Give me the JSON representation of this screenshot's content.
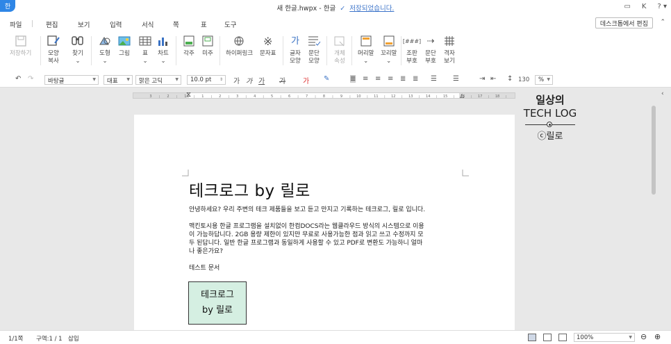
{
  "app": {
    "logo_char": "한",
    "title": "새 한글.hwpx - 한글",
    "save_status": "저장되었습니다.",
    "right_icons": [
      "message-icon",
      "K",
      "?"
    ]
  },
  "menu": {
    "items": [
      "파일",
      "편집",
      "보기",
      "입력",
      "서식",
      "쪽",
      "표",
      "도구"
    ],
    "desktop_button": "데스크톱에서 편집"
  },
  "ribbon": {
    "buttons": [
      {
        "label": "저장하기",
        "icon": "save-icon",
        "disabled": true
      },
      {
        "label": "모양\n복사",
        "icon": "format-painter-icon"
      },
      {
        "label": "찾기",
        "icon": "find-icon"
      },
      {
        "label": "도형",
        "icon": "shape-icon"
      },
      {
        "label": "그림",
        "icon": "picture-icon"
      },
      {
        "label": "표",
        "icon": "table-icon"
      },
      {
        "label": "차트",
        "icon": "chart-icon"
      },
      {
        "label": "각주",
        "icon": "footnote-icon"
      },
      {
        "label": "미주",
        "icon": "endnote-icon"
      },
      {
        "label": "하이퍼링크",
        "icon": "hyperlink-icon"
      },
      {
        "label": "문자표",
        "icon": "symbol-icon"
      },
      {
        "label": "글자\n모양",
        "icon": "char-shape-icon"
      },
      {
        "label": "문단\n모양",
        "icon": "para-shape-icon"
      },
      {
        "label": "개체\n속성",
        "icon": "object-prop-icon",
        "disabled": true
      },
      {
        "label": "머리말",
        "icon": "header-icon"
      },
      {
        "label": "꼬리말",
        "icon": "footer-icon"
      },
      {
        "label": "조판\n부호",
        "icon": "layout-code-icon"
      },
      {
        "label": "문단\n부호",
        "icon": "para-mark-icon"
      },
      {
        "label": "격자\n보기",
        "icon": "grid-icon"
      }
    ]
  },
  "format": {
    "style": "바탕글",
    "lang": "대표",
    "font": "맑은 고딕",
    "size": "10.0",
    "size_unit": "pt",
    "line_spacing": "130",
    "line_unit": "%"
  },
  "ruler": {
    "marks": [
      "3",
      "2",
      "1",
      "1",
      "2",
      "3",
      "4",
      "5",
      "6",
      "7",
      "8",
      "9",
      "10",
      "11",
      "12",
      "13",
      "14",
      "15",
      "16",
      "17",
      "18"
    ]
  },
  "document": {
    "title": "테크로그 by 릴로",
    "p1": "안녕하세요? 우리 주변의 테크 제품들을 보고 듣고 만지고 기록하는 테크로그, 릴로 입니다.",
    "p2_l1": "맥킨토시용 한글 프로그램을 설치없이 한컴DOCS라는 웹클라우드 방식의 시스템으로 이용",
    "p2_l2": "이 가능하답니다. 2GB 용량 제한이 있지만 무료로 사용가능한 점과 읽고 쓰고 수정까지 모",
    "p2_l3": "두 된답니다. 일반 한글 프로그램과 동일하게 사용할 수 있고 PDF로 변환도 가능하니 얼마",
    "p2_l4": "나 좋은가요?",
    "p3": "테스트 문서",
    "box_l1": "테크로그",
    "box_l2": "by 릴로"
  },
  "watermark": {
    "line1": "일상의",
    "line2": "TECH LOG",
    "line3": "ⓒ릴로"
  },
  "status": {
    "page": "1/1쪽",
    "section": "구역:1 / 1",
    "mode": "삽입",
    "zoom": "100%"
  }
}
